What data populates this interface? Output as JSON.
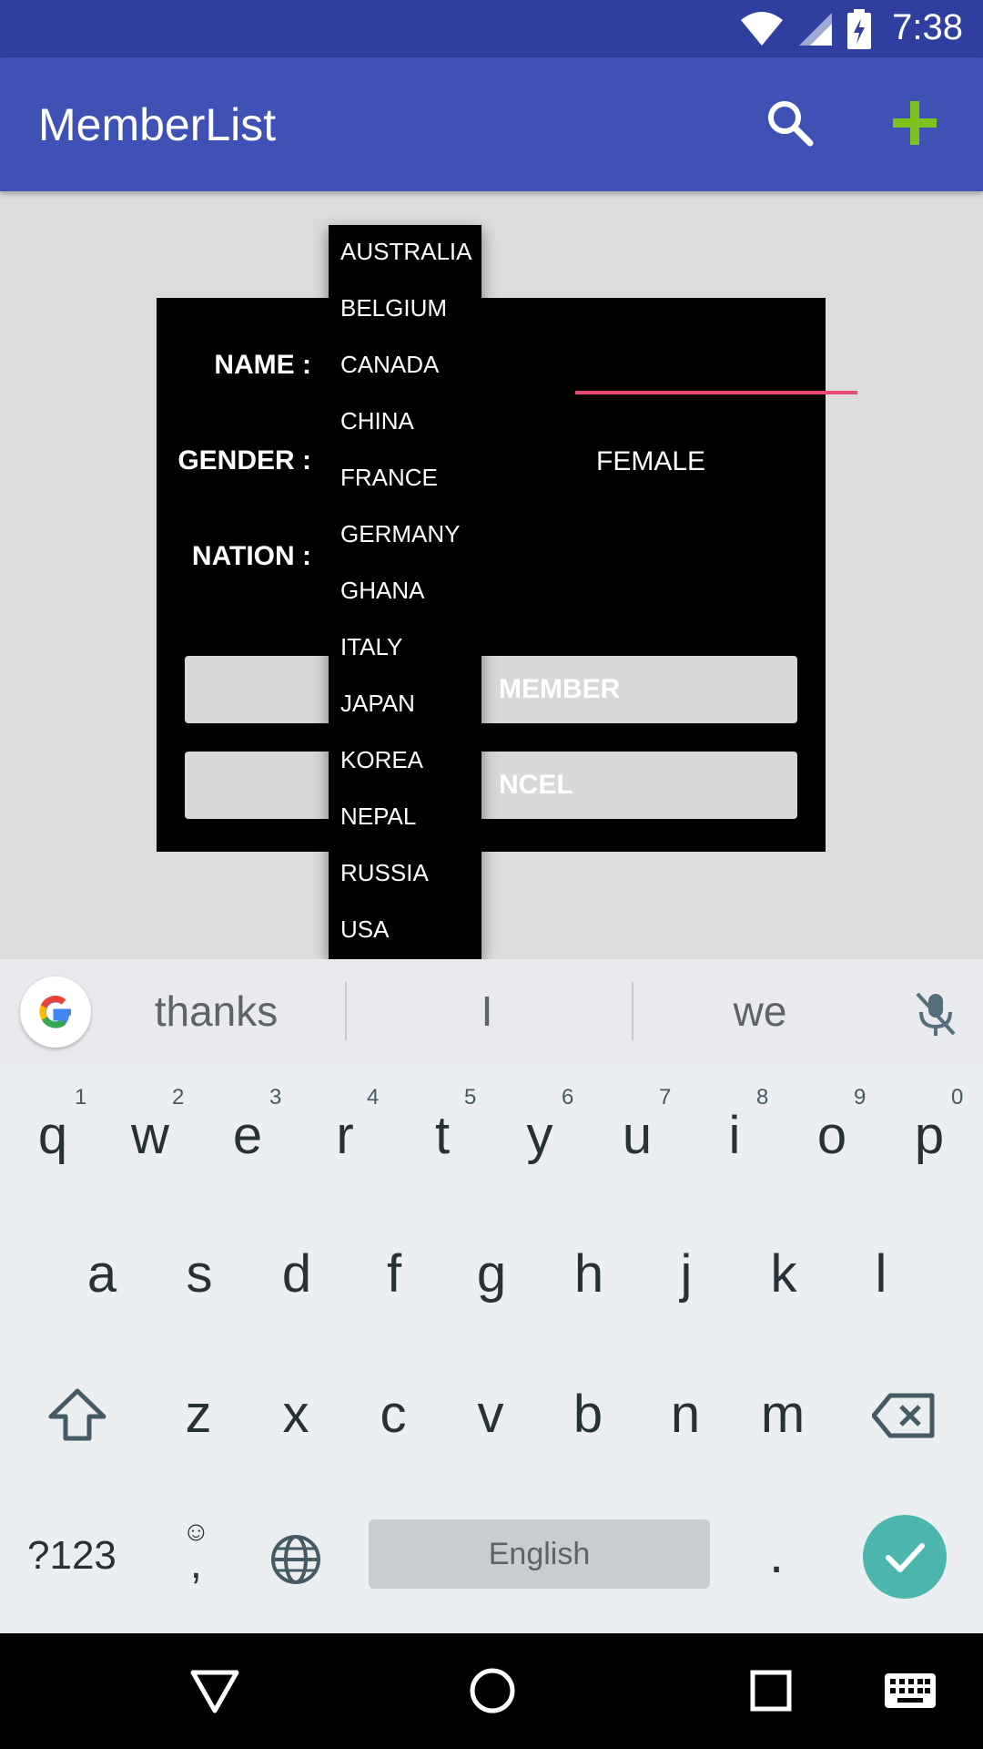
{
  "status_bar": {
    "time": "7:38",
    "icons": [
      "wifi-icon",
      "signal-icon",
      "battery-charging-icon"
    ]
  },
  "app_bar": {
    "title": "MemberList",
    "search_icon": "search-icon",
    "add_icon": "add-icon",
    "add_color": "#7cc31e"
  },
  "dialog": {
    "name_label": "NAME :",
    "gender_label": "GENDER :",
    "nation_label": "NATION :",
    "female_label": "FEMALE",
    "add_member_visible": "MEMBER",
    "cancel_visible": "NCEL",
    "accent_color": "#e84a74"
  },
  "dropdown": {
    "items": [
      "AUSTRALIA",
      "BELGIUM",
      "CANADA",
      "CHINA",
      "FRANCE",
      "GERMANY",
      "GHANA",
      "ITALY",
      "JAPAN",
      "KOREA",
      "NEPAL",
      "RUSSIA",
      "USA"
    ]
  },
  "keyboard": {
    "suggestions": [
      "thanks",
      "I",
      "we"
    ],
    "row1": [
      "q",
      "w",
      "e",
      "r",
      "t",
      "y",
      "u",
      "i",
      "o",
      "p"
    ],
    "row1_numbers": [
      "1",
      "2",
      "3",
      "4",
      "5",
      "6",
      "7",
      "8",
      "9",
      "0"
    ],
    "row2": [
      "a",
      "s",
      "d",
      "f",
      "g",
      "h",
      "j",
      "k",
      "l"
    ],
    "row3": [
      "z",
      "x",
      "c",
      "v",
      "b",
      "n",
      "m"
    ],
    "symbols_key": "?123",
    "emoji_glyph": "☺",
    "comma": ",",
    "space_label": "English",
    "period": ".",
    "enter_color": "#4db6ac"
  },
  "nav_bar": {
    "icons": [
      "back-icon",
      "home-icon",
      "recents-icon",
      "keyboard-icon"
    ]
  }
}
